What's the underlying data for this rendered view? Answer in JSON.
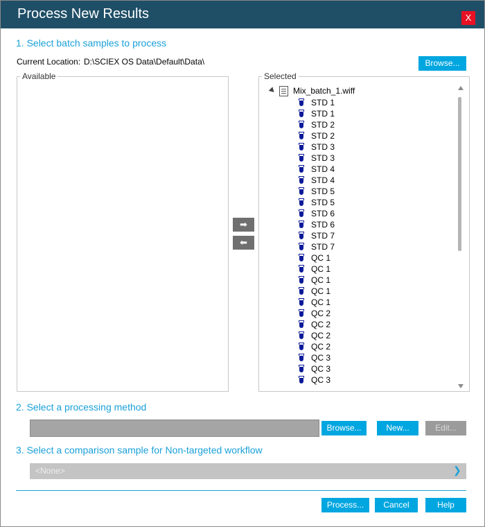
{
  "window": {
    "title": "Process New Results",
    "close_label": "X"
  },
  "section1": {
    "label": "1. Select batch samples to process",
    "current_location_label": "Current Location:",
    "current_location_value": "D:\\SCIEX OS Data\\Default\\Data\\",
    "browse_label": "Browse...",
    "available_label": "Available",
    "selected_label": "Selected",
    "move_right_icon": "arrow-right-icon",
    "move_left_icon": "arrow-left-icon",
    "tree": {
      "root": "Mix_batch_1.wiff",
      "samples": [
        "STD 1",
        "STD 1",
        "STD 2",
        "STD 2",
        "STD 3",
        "STD 3",
        "STD 4",
        "STD 4",
        "STD 5",
        "STD 5",
        "STD 6",
        "STD 6",
        "STD 7",
        "STD 7",
        "QC 1",
        "QC 1",
        "QC 1",
        "QC 1",
        "QC 1",
        "QC 2",
        "QC 2",
        "QC 2",
        "QC 2",
        "QC 3",
        "QC 3",
        "QC 3"
      ]
    }
  },
  "section2": {
    "label": "2. Select a processing method",
    "method_value": "",
    "browse_label": "Browse...",
    "new_label": "New...",
    "edit_label": "Edit..."
  },
  "section3": {
    "label": "3. Select a comparison sample for Non-targeted workflow",
    "selected_value": "<None>"
  },
  "footer": {
    "process_label": "Process...",
    "cancel_label": "Cancel",
    "help_label": "Help"
  },
  "colors": {
    "titlebar": "#1f4f67",
    "accent": "#00a6e0",
    "section_text": "#1aa0d8",
    "disabled": "#9b9b9b",
    "close": "#e81123"
  }
}
